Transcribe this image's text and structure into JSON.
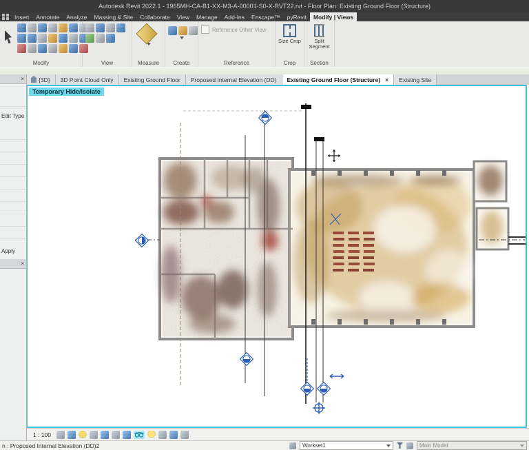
{
  "title_bar": {
    "title": "Autodesk Revit 2022.1 - 1965MH-CA-B1-XX-M3-A-00001-S0-X-RVT22.rvt - Floor Plan: Existing Ground Floor (Structure)"
  },
  "menu": {
    "tabs": [
      "Insert",
      "Annotate",
      "Analyze",
      "Massing & Site",
      "Collaborate",
      "View",
      "Manage",
      "Add-Ins",
      "Enscape™",
      "pyRevit"
    ],
    "active_tab": "Modify | Views"
  },
  "ribbon": {
    "panels": {
      "modify": "Modify",
      "view": "View",
      "measure": "Measure",
      "create": "Create",
      "reference": "Reference",
      "crop": "Crop",
      "section": "Section"
    },
    "reference_checkbox": "Reference Other View",
    "size_crop": "Size Crop",
    "split_segment": "Split Segment"
  },
  "view_tabs": [
    {
      "label": "{3D}"
    },
    {
      "label": "3D Point Cloud Only"
    },
    {
      "label": "Existing Ground Floor"
    },
    {
      "label": "Proposed Internal Elevation (DD)"
    },
    {
      "label": "Existing Ground Floor (Structure)",
      "close": "×"
    },
    {
      "label": "Existing Site"
    }
  ],
  "left_panel": {
    "close": "×",
    "edit_type": "Edit Type",
    "apply": "Apply",
    "close2": "×"
  },
  "canvas": {
    "hide_isolate": "Temporary Hide/Isolate"
  },
  "view_controls": {
    "scale": "1 : 100"
  },
  "status_bar": {
    "view_text": "n : Proposed Internal Elevation (DD)2",
    "workset": "Workset1",
    "design_option": "Main Model"
  }
}
